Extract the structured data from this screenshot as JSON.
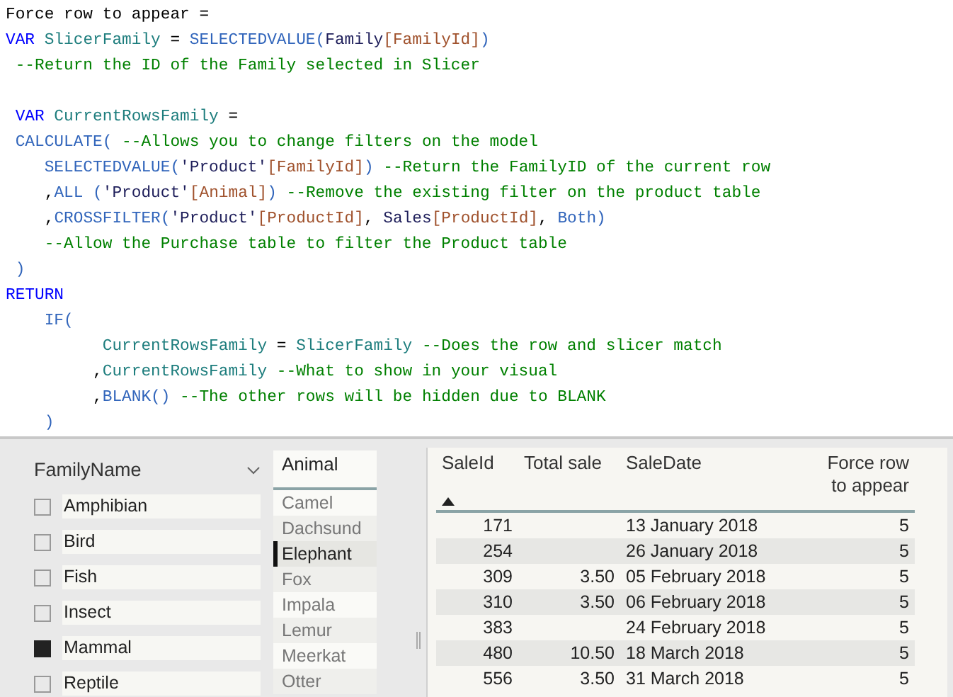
{
  "code_editor": {
    "lines": [
      {
        "gap_before": false,
        "tokens": [
          {
            "kind": "plain",
            "text": "Force row to appear ="
          }
        ]
      },
      {
        "gap_before": false,
        "tokens": [
          {
            "kind": "keyword",
            "text": "VAR"
          },
          {
            "kind": "variable",
            "text": " SlicerFamily"
          },
          {
            "kind": "plain",
            "text": " = "
          },
          {
            "kind": "function",
            "text": "SELECTEDVALUE("
          },
          {
            "kind": "table",
            "text": "Family"
          },
          {
            "kind": "column",
            "text": "[FamilyId]"
          },
          {
            "kind": "function",
            "text": ")"
          }
        ]
      },
      {
        "gap_before": false,
        "tokens": [
          {
            "kind": "comment",
            "text": " --Return the ID of the Family selected in Slicer"
          }
        ]
      },
      {
        "gap_before": true,
        "tokens": [
          {
            "kind": "keyword",
            "text": " VAR"
          },
          {
            "kind": "variable",
            "text": " CurrentRowsFamily"
          },
          {
            "kind": "plain",
            "text": " ="
          }
        ]
      },
      {
        "gap_before": false,
        "tokens": [
          {
            "kind": "function",
            "text": " CALCULATE("
          },
          {
            "kind": "comment",
            "text": " --Allows you to change filters on the model"
          }
        ]
      },
      {
        "gap_before": false,
        "tokens": [
          {
            "kind": "function",
            "text": "    SELECTEDVALUE("
          },
          {
            "kind": "table",
            "text": "'Product'"
          },
          {
            "kind": "column",
            "text": "[FamilyId]"
          },
          {
            "kind": "function",
            "text": ")"
          },
          {
            "kind": "comment",
            "text": " --Return the FamilyID of the current row"
          }
        ]
      },
      {
        "gap_before": false,
        "tokens": [
          {
            "kind": "plain",
            "text": "    ,"
          },
          {
            "kind": "function",
            "text": "ALL ("
          },
          {
            "kind": "table",
            "text": "'Product'"
          },
          {
            "kind": "column",
            "text": "[Animal]"
          },
          {
            "kind": "function",
            "text": ")"
          },
          {
            "kind": "comment",
            "text": " --Remove the existing filter on the product table"
          }
        ]
      },
      {
        "gap_before": false,
        "tokens": [
          {
            "kind": "plain",
            "text": "    ,"
          },
          {
            "kind": "function",
            "text": "CROSSFILTER("
          },
          {
            "kind": "table",
            "text": "'Product'"
          },
          {
            "kind": "column",
            "text": "[ProductId]"
          },
          {
            "kind": "plain",
            "text": ", "
          },
          {
            "kind": "table",
            "text": "Sales"
          },
          {
            "kind": "column",
            "text": "[ProductId]"
          },
          {
            "kind": "plain",
            "text": ", "
          },
          {
            "kind": "function",
            "text": "Both)"
          }
        ]
      },
      {
        "gap_before": false,
        "tokens": [
          {
            "kind": "comment",
            "text": "    --Allow the Purchase table to filter the Product table"
          }
        ]
      },
      {
        "gap_before": false,
        "tokens": [
          {
            "kind": "function",
            "text": " )"
          }
        ]
      },
      {
        "gap_before": false,
        "tokens": [
          {
            "kind": "keyword",
            "text": "RETURN"
          }
        ]
      },
      {
        "gap_before": false,
        "tokens": [
          {
            "kind": "function",
            "text": "    IF("
          }
        ]
      },
      {
        "gap_before": false,
        "tokens": [
          {
            "kind": "variable",
            "text": "          CurrentRowsFamily"
          },
          {
            "kind": "plain",
            "text": " = "
          },
          {
            "kind": "variable",
            "text": "SlicerFamily"
          },
          {
            "kind": "comment",
            "text": " --Does the row and slicer match"
          }
        ]
      },
      {
        "gap_before": false,
        "tokens": [
          {
            "kind": "plain",
            "text": "         ,"
          },
          {
            "kind": "variable",
            "text": "CurrentRowsFamily"
          },
          {
            "kind": "comment",
            "text": " --What to show in your visual"
          }
        ]
      },
      {
        "gap_before": false,
        "tokens": [
          {
            "kind": "plain",
            "text": "         ,"
          },
          {
            "kind": "function",
            "text": "BLANK()"
          },
          {
            "kind": "comment",
            "text": " --The other rows will be hidden due to BLANK"
          }
        ]
      },
      {
        "gap_before": false,
        "tokens": [
          {
            "kind": "function",
            "text": "    )"
          }
        ]
      }
    ]
  },
  "family_slicer": {
    "title": "FamilyName",
    "items": [
      {
        "label": "Amphibian",
        "checked": false
      },
      {
        "label": "Bird",
        "checked": false
      },
      {
        "label": "Fish",
        "checked": false
      },
      {
        "label": "Insect",
        "checked": false
      },
      {
        "label": "Mammal",
        "checked": true
      },
      {
        "label": "Reptile",
        "checked": false
      }
    ]
  },
  "animal_list": {
    "title": "Animal",
    "items": [
      {
        "label": "Camel",
        "selected": false
      },
      {
        "label": "Dachsund",
        "selected": false
      },
      {
        "label": "Elephant",
        "selected": true
      },
      {
        "label": "Fox",
        "selected": false
      },
      {
        "label": "Impala",
        "selected": false
      },
      {
        "label": "Lemur",
        "selected": false
      },
      {
        "label": "Meerkat",
        "selected": false
      },
      {
        "label": "Otter",
        "selected": false
      }
    ]
  },
  "sales_table": {
    "columns": [
      {
        "label": "SaleId",
        "sorted_ascending": true
      },
      {
        "label": "Total sale",
        "sorted_ascending": false
      },
      {
        "label": "SaleDate",
        "sorted_ascending": false
      },
      {
        "label": "Force row to appear",
        "sorted_ascending": false
      }
    ],
    "rows": [
      {
        "sale_id": "171",
        "sale_date": "13 January 2018",
        "force_row": "5"
      },
      {
        "sale_id": "254",
        "sale_date": "26 January 2018",
        "force_row": "5"
      },
      {
        "sale_id": "309",
        "total_sale": "3.50",
        "sale_date": "05 February 2018",
        "force_row": "5"
      },
      {
        "sale_id": "310",
        "total_sale": "3.50",
        "sale_date": "06 February 2018",
        "force_row": "5"
      },
      {
        "sale_id": "383",
        "sale_date": "24 February 2018",
        "force_row": "5"
      },
      {
        "sale_id": "480",
        "total_sale": "10.50",
        "sale_date": "18 March 2018",
        "force_row": "5"
      },
      {
        "sale_id": "556",
        "total_sale": "3.50",
        "sale_date": "31 March 2018",
        "force_row": "5"
      }
    ]
  }
}
